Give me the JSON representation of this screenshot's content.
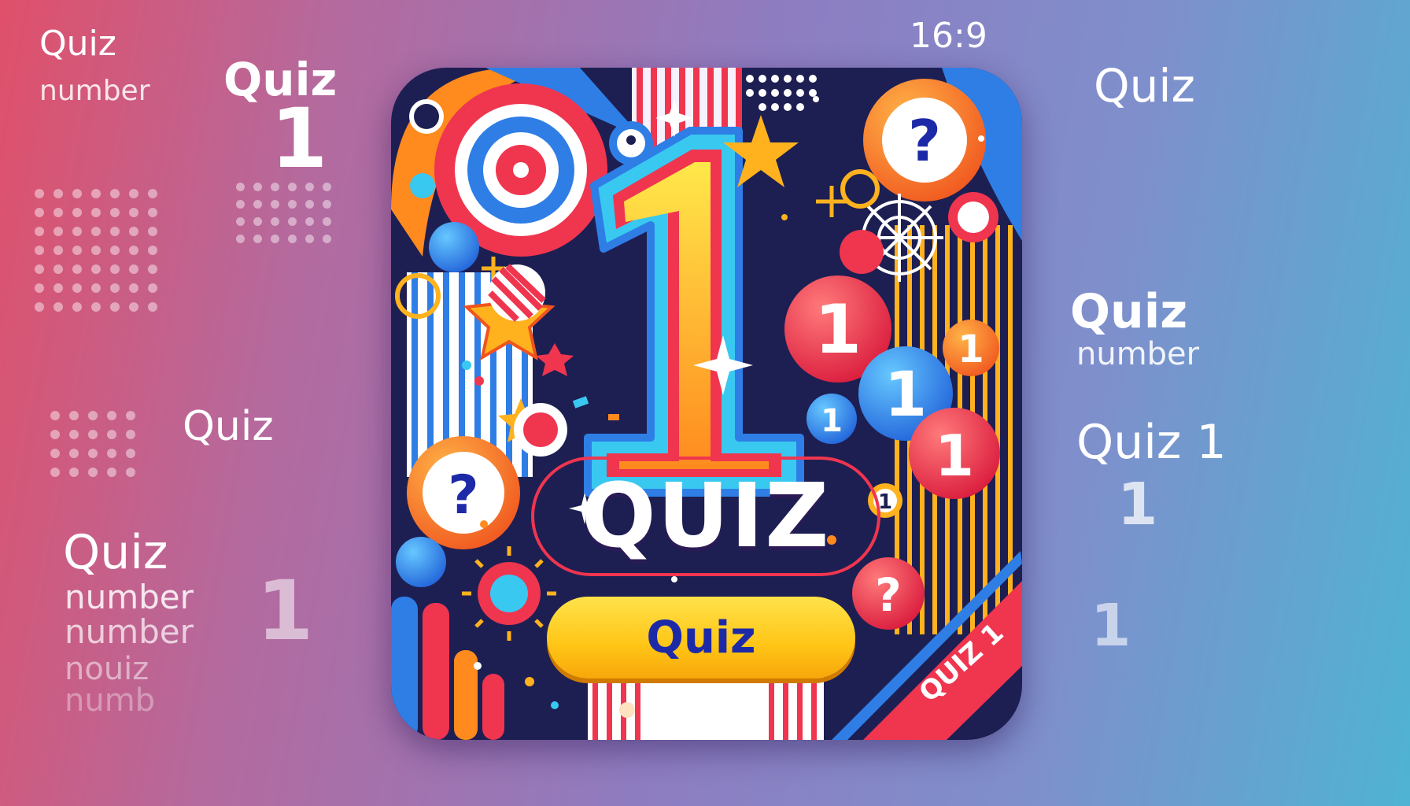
{
  "aspect_label": "16:9",
  "left": {
    "quiz_small": "Quiz",
    "number_small": "number",
    "quiz_big": "Quiz",
    "one_big": "1",
    "quiz_mid": "Quiz",
    "stack_quiz": "Quiz",
    "stack_number1": "number",
    "stack_number2": "number",
    "stack_noise1": "nouiz",
    "stack_noise2": "numb",
    "one_faint": "1"
  },
  "right": {
    "quiz_top": "Quiz",
    "quiz_mid": "Quiz",
    "number_mid": "number",
    "quiz1": "Quiz 1",
    "one_a": "1",
    "one_b": "1"
  },
  "card": {
    "big_number": "1",
    "title": "QUIZ",
    "button_label": "Quiz",
    "ribbon_label": "QUIZ 1",
    "badges": {
      "question": "?",
      "one": "1"
    }
  },
  "colors": {
    "card_bg": "#1d1f52",
    "yellow": "#ffc516",
    "orange": "#ff8a1e",
    "red": "#f0354f",
    "blue": "#2e7ee6",
    "cyan": "#39c8f0",
    "button_text": "#1d2aa8"
  }
}
